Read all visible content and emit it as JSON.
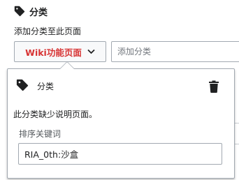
{
  "header": {
    "title": "分类",
    "icon": "tag-icon"
  },
  "subheading": "添加分类至此页面",
  "category_chip": {
    "label": "Wiki功能页面",
    "color": "#d73333",
    "icon": "chevron-down-icon"
  },
  "add_category": {
    "placeholder": "添加分类",
    "value": ""
  },
  "popup": {
    "icon": "tag-icon",
    "title": "分类",
    "delete_icon": "trash-icon",
    "missing_notice": "此分类缺少说明页面。",
    "sortkey_label": "排序关键词",
    "sortkey_value": "RIA_0th:沙盒"
  }
}
